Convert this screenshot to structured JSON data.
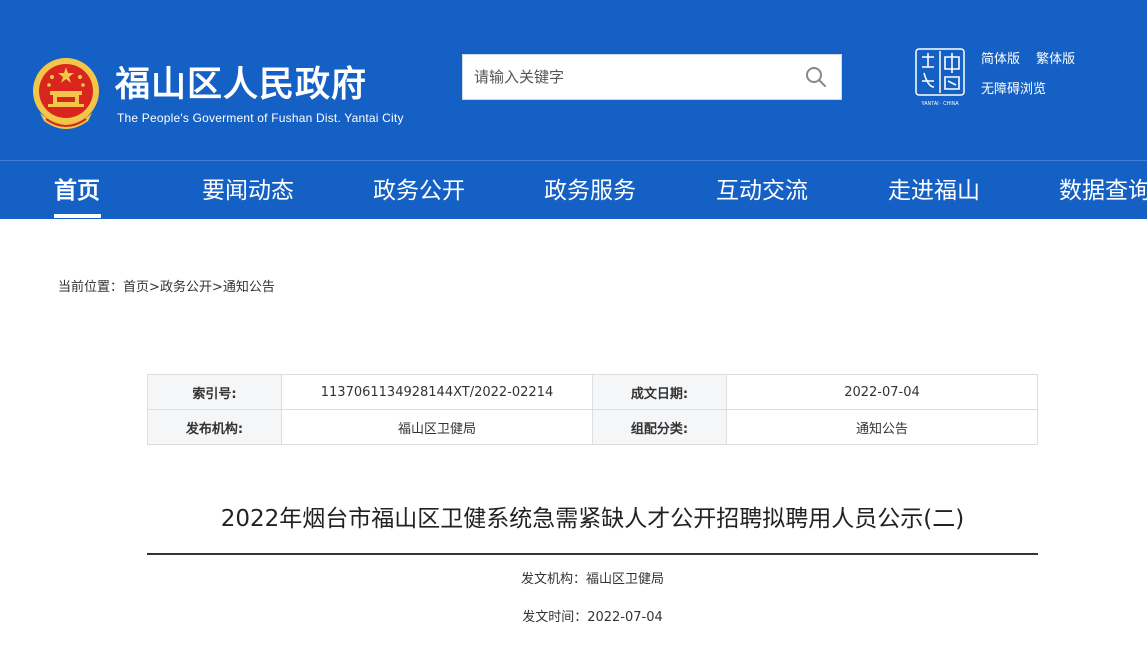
{
  "header": {
    "title": "福山区人民政府",
    "subtitle": "The People's Goverment of Fushan Dist. Yantai City",
    "emblem_icon": "national-emblem-icon",
    "search": {
      "placeholder": "请输入关键字",
      "value": ""
    },
    "yantai_logo_caption": "YANTAI · CHINA",
    "links": {
      "simplified": "简体版",
      "traditional": "繁体版",
      "accessible": "无障碍浏览"
    }
  },
  "nav": {
    "items": [
      {
        "label": "首页",
        "active": true
      },
      {
        "label": "要闻动态"
      },
      {
        "label": "政务公开"
      },
      {
        "label": "政务服务"
      },
      {
        "label": "互动交流"
      },
      {
        "label": "走进福山"
      },
      {
        "label": "数据查询"
      }
    ]
  },
  "breadcrumb": {
    "prefix": "当前位置：",
    "items": [
      "首页",
      "政务公开",
      "通知公告"
    ],
    "separator": ">"
  },
  "meta": {
    "index_label": "索引号:",
    "index_value": "1137061134928144XT/2022-02214",
    "date_label": "成文日期:",
    "date_value": "2022-07-04",
    "publisher_label": "发布机构:",
    "publisher_value": "福山区卫健局",
    "category_label": "组配分类:",
    "category_value": "通知公告"
  },
  "article": {
    "title": "2022年烟台市福山区卫健系统急需紧缺人才公开招聘拟聘用人员公示(二)",
    "org_line": "发文机构：福山区卫健局",
    "date_line": "发文时间：2022-07-04"
  },
  "colors": {
    "brand_blue": "#1560c4",
    "emblem_red": "#d8261e",
    "emblem_gold": "#f3c64a"
  }
}
